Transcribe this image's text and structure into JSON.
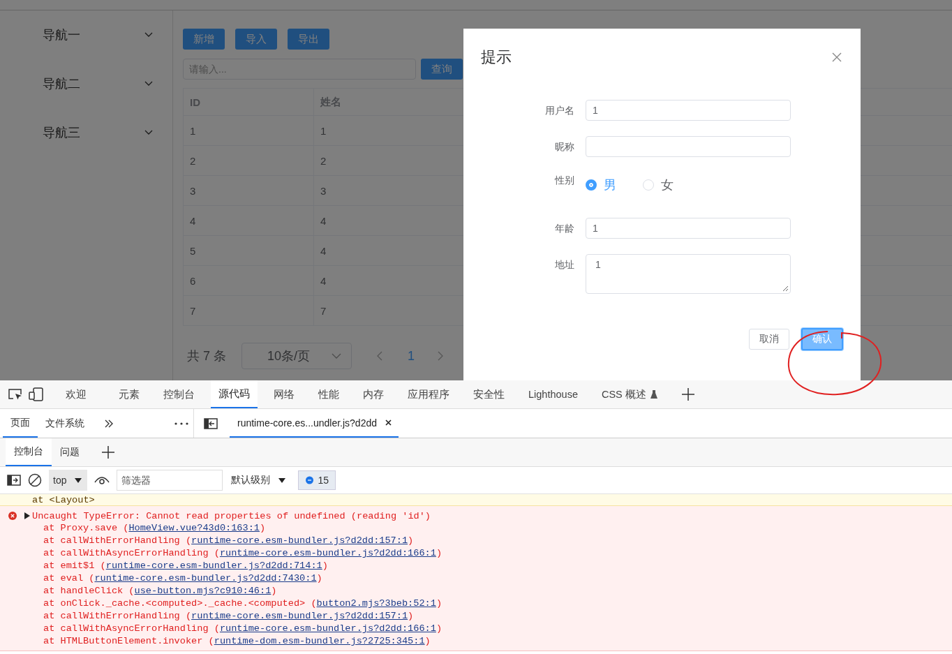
{
  "sidebar": {
    "items": [
      {
        "label": "导航一",
        "expanded": false
      },
      {
        "label": "导航二",
        "expanded": false
      },
      {
        "label": "导航三",
        "expanded": false
      }
    ]
  },
  "toolbar": {
    "buttons": [
      "新增",
      "导入",
      "导出"
    ]
  },
  "search": {
    "placeholder": "请输入...",
    "button": "查询"
  },
  "table": {
    "columns": [
      "ID",
      "姓名"
    ],
    "rows": [
      [
        "1",
        "1"
      ],
      [
        "2",
        "2"
      ],
      [
        "3",
        "3"
      ],
      [
        "4",
        "4"
      ],
      [
        "5",
        "4"
      ],
      [
        "6",
        "4"
      ],
      [
        "7",
        "7"
      ]
    ]
  },
  "pagination": {
    "total": "共 7 条",
    "page_size": "10条/页",
    "pages": [
      {
        "label": "1",
        "selected": true
      }
    ]
  },
  "dialog": {
    "title": "提示",
    "fields": [
      {
        "kind": "input",
        "label": "用户名",
        "value": "1"
      },
      {
        "kind": "input",
        "label": "昵称"
      },
      {
        "kind": "radio",
        "label": "性别",
        "options": [
          {
            "label": "男",
            "selected": true
          },
          {
            "label": "女",
            "selected": false
          }
        ]
      },
      {
        "kind": "input",
        "label": "年龄",
        "value": "1"
      },
      {
        "kind": "textarea",
        "label": "地址",
        "value": "1"
      }
    ],
    "buttons": [
      {
        "label": "取消",
        "kind": "default"
      },
      {
        "label": "确认",
        "kind": "primary"
      }
    ]
  },
  "devtools": {
    "tabs": [
      {
        "label": "欢迎",
        "selected": false
      },
      {
        "label": "元素",
        "selected": false
      },
      {
        "label": "控制台",
        "selected": false
      },
      {
        "label": "源代码",
        "selected": true
      },
      {
        "label": "网络",
        "selected": false
      },
      {
        "label": "性能",
        "selected": false
      },
      {
        "label": "内存",
        "selected": false
      },
      {
        "label": "应用程序",
        "selected": false
      },
      {
        "label": "安全性",
        "selected": false
      },
      {
        "label": "Lighthouse",
        "selected": false
      },
      {
        "label": "CSS 概述",
        "selected": false,
        "experimental": true
      }
    ],
    "sources_tabs": [
      {
        "label": "页面",
        "selected": true
      },
      {
        "label": "文件系统",
        "selected": false
      }
    ],
    "open_file": "runtime-core.es...undler.js?d2dd",
    "drawer_tabs": [
      {
        "label": "控制台",
        "selected": true
      },
      {
        "label": "问题",
        "selected": false
      }
    ],
    "console_toolbar": {
      "context": "top",
      "filter_placeholder": "筛选器",
      "level": "默认级别",
      "message_count": "15"
    },
    "messages": [
      {
        "kind": "warning",
        "lines": [
          {
            "pre": "at <Layout>"
          }
        ]
      },
      {
        "kind": "error",
        "text": "Uncaught TypeError: Cannot read properties of undefined (reading 'id')",
        "lines": [
          {
            "pre": "at Proxy.save (",
            "link": "HomeView.vue?43d0:163:1",
            "post": ")"
          },
          {
            "pre": "at callWithErrorHandling (",
            "link": "runtime-core.esm-bundler.js?d2dd:157:1",
            "post": ")"
          },
          {
            "pre": "at callWithAsyncErrorHandling (",
            "link": "runtime-core.esm-bundler.js?d2dd:166:1",
            "post": ")"
          },
          {
            "pre": "at emit$1 (",
            "link": "runtime-core.esm-bundler.js?d2dd:714:1",
            "post": ")"
          },
          {
            "pre": "at eval (",
            "link": "runtime-core.esm-bundler.js?d2dd:7430:1",
            "post": ")"
          },
          {
            "pre": "at handleClick (",
            "link": "use-button.mjs?c910:46:1",
            "post": ")"
          },
          {
            "pre": "at onClick._cache.<computed>._cache.<computed> (",
            "link": "button2.mjs?3beb:52:1",
            "post": ")"
          },
          {
            "pre": "at callWithErrorHandling (",
            "link": "runtime-core.esm-bundler.js?d2dd:157:1",
            "post": ")"
          },
          {
            "pre": "at callWithAsyncErrorHandling (",
            "link": "runtime-core.esm-bundler.js?d2dd:166:1",
            "post": ")"
          },
          {
            "pre": "at HTMLButtonElement.invoker (",
            "link": "runtime-dom.esm-bundler.js?2725:345:1",
            "post": ")"
          }
        ]
      }
    ]
  }
}
